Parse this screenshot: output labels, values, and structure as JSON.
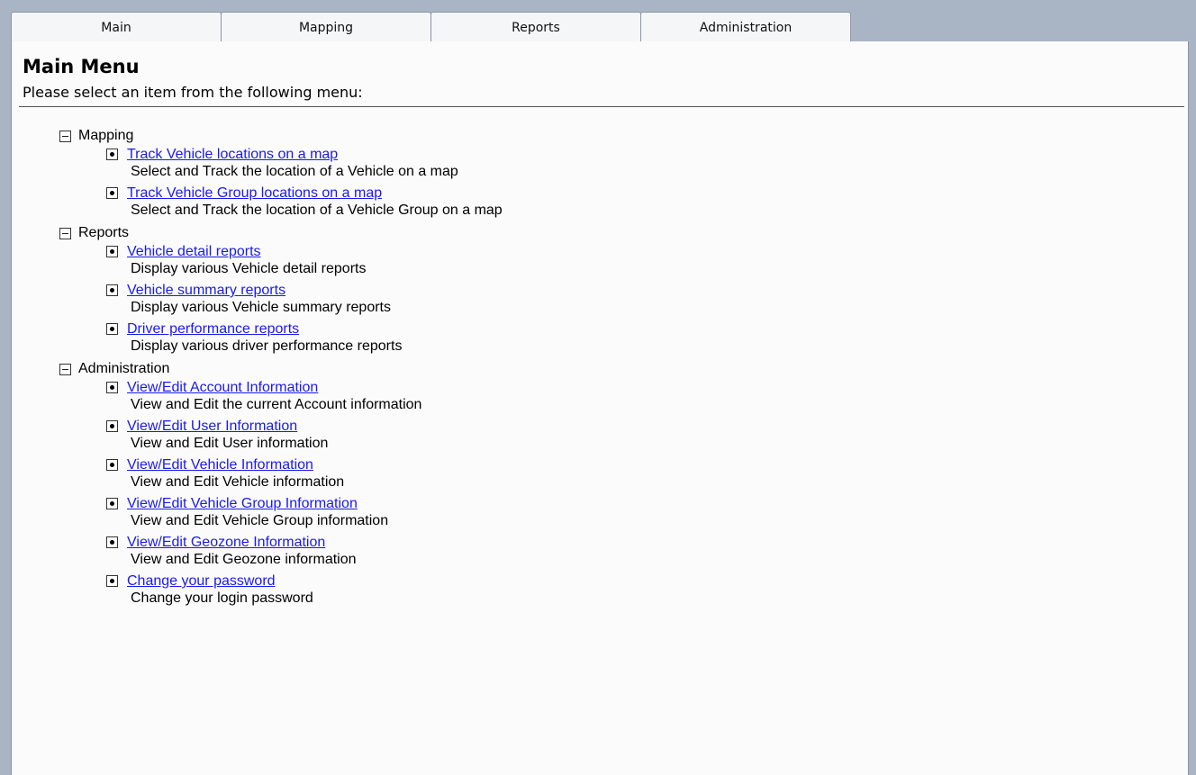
{
  "tabs": [
    {
      "label": "Main"
    },
    {
      "label": "Mapping"
    },
    {
      "label": "Reports"
    },
    {
      "label": "Administration"
    }
  ],
  "page": {
    "title": "Main Menu",
    "subtitle": "Please select an item from the following menu:"
  },
  "sections": [
    {
      "label": "Mapping",
      "items": [
        {
          "link": "Track Vehicle locations on a map",
          "desc": "Select and Track the location of a Vehicle on a map"
        },
        {
          "link": "Track Vehicle Group locations on a map",
          "desc": "Select and Track the location of a Vehicle Group on a map"
        }
      ]
    },
    {
      "label": "Reports",
      "items": [
        {
          "link": "Vehicle detail reports",
          "desc": "Display various Vehicle detail reports"
        },
        {
          "link": "Vehicle summary reports",
          "desc": "Display various Vehicle summary reports"
        },
        {
          "link": "Driver performance reports",
          "desc": "Display various driver performance reports"
        }
      ]
    },
    {
      "label": "Administration",
      "items": [
        {
          "link": "View/Edit Account Information",
          "desc": "View and Edit the current Account information"
        },
        {
          "link": "View/Edit User Information",
          "desc": "View and Edit User information"
        },
        {
          "link": "View/Edit Vehicle Information",
          "desc": "View and Edit Vehicle information"
        },
        {
          "link": "View/Edit Vehicle Group Information",
          "desc": "View and Edit Vehicle Group information"
        },
        {
          "link": "View/Edit Geozone Information",
          "desc": "View and Edit Geozone information"
        },
        {
          "link": "Change your password",
          "desc": "Change your login password"
        }
      ]
    }
  ]
}
